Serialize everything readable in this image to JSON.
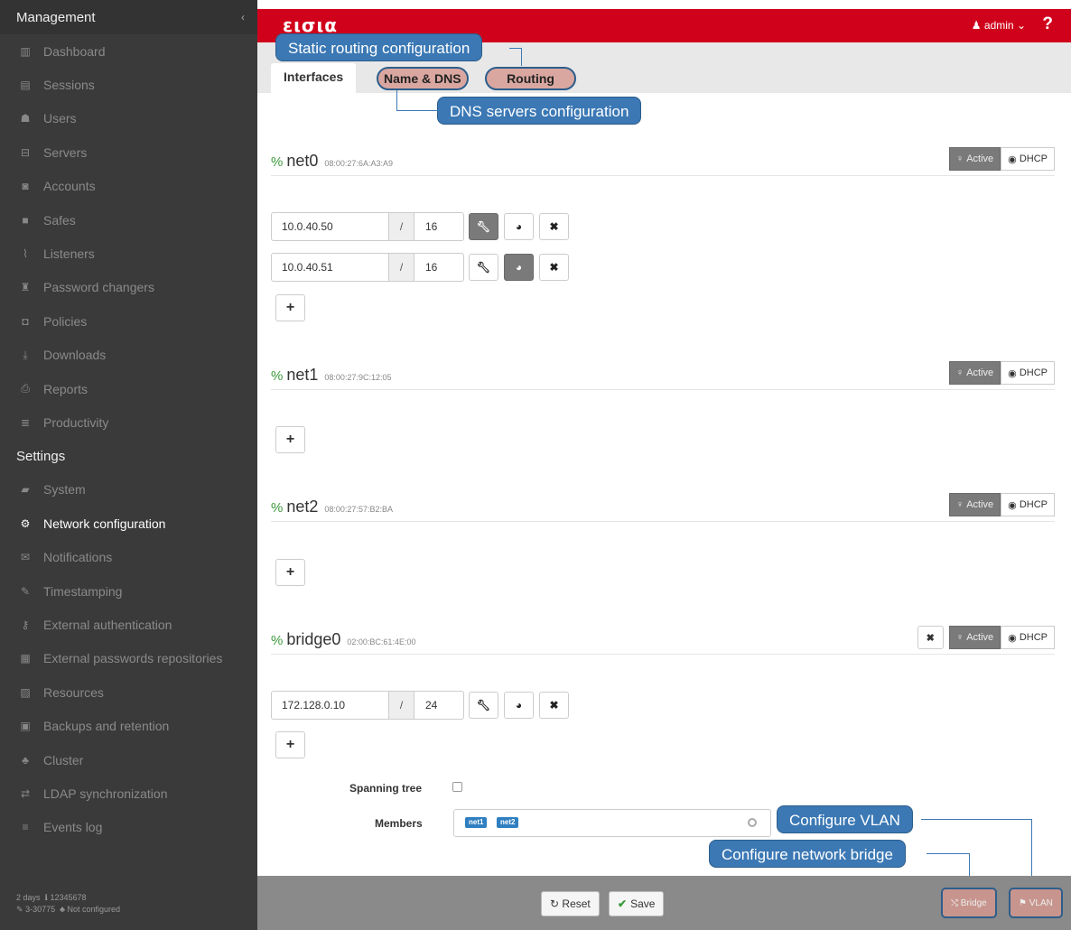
{
  "sidebar": {
    "management_title": "Management",
    "collapse_icon": "chevron-left-icon",
    "management_items": [
      {
        "label": "Dashboard",
        "icon": "dashboard-icon"
      },
      {
        "label": "Sessions",
        "icon": "sessions-icon"
      },
      {
        "label": "Users",
        "icon": "users-icon"
      },
      {
        "label": "Servers",
        "icon": "servers-icon"
      },
      {
        "label": "Accounts",
        "icon": "accounts-icon"
      },
      {
        "label": "Safes",
        "icon": "safes-icon"
      },
      {
        "label": "Listeners",
        "icon": "listeners-icon"
      },
      {
        "label": "Password changers",
        "icon": "password-changers-icon"
      },
      {
        "label": "Policies",
        "icon": "policies-icon"
      },
      {
        "label": "Downloads",
        "icon": "downloads-icon"
      },
      {
        "label": "Reports",
        "icon": "reports-icon"
      },
      {
        "label": "Productivity",
        "icon": "productivity-icon"
      }
    ],
    "settings_title": "Settings",
    "settings_items": [
      {
        "label": "System",
        "icon": "folder-icon"
      },
      {
        "label": "Network configuration",
        "icon": "gears-icon",
        "active": true
      },
      {
        "label": "Notifications",
        "icon": "envelope-icon"
      },
      {
        "label": "Timestamping",
        "icon": "edit-icon"
      },
      {
        "label": "External authentication",
        "icon": "key-icon"
      },
      {
        "label": "External passwords repositories",
        "icon": "grid-icon"
      },
      {
        "label": "Resources",
        "icon": "image-icon"
      },
      {
        "label": "Backups and retention",
        "icon": "archive-icon"
      },
      {
        "label": "Cluster",
        "icon": "sitemap-icon"
      },
      {
        "label": "LDAP synchronization",
        "icon": "exchange-icon"
      },
      {
        "label": "Events log",
        "icon": "list-icon"
      }
    ],
    "footer": {
      "uptime": "2 days",
      "serial": "12345678",
      "version": "3-30775",
      "cluster": "Not configured"
    }
  },
  "topbar": {
    "logo": "εισια",
    "user": "admin",
    "help": "?"
  },
  "tabs": {
    "interfaces": "Interfaces",
    "name_dns": "Name & DNS",
    "routing": "Routing"
  },
  "callouts": {
    "routing": "Static routing configuration",
    "dns": "DNS servers configuration",
    "vlan": "Configure VLAN",
    "bridge": "Configure network bridge"
  },
  "interfaces": [
    {
      "name": "net0",
      "mac": "08:00:27:6A:A3:A9",
      "active_label": "Active",
      "dhcp_label": "DHCP",
      "addresses": [
        {
          "ip": "10.0.40.50",
          "mask": "16"
        },
        {
          "ip": "10.0.40.51",
          "mask": "16"
        }
      ]
    },
    {
      "name": "net1",
      "mac": "08:00:27:9C:12:05",
      "active_label": "Active",
      "dhcp_label": "DHCP",
      "addresses": []
    },
    {
      "name": "net2",
      "mac": "08:00:27:57:B2:BA",
      "active_label": "Active",
      "dhcp_label": "DHCP",
      "addresses": []
    },
    {
      "name": "bridge0",
      "mac": "02:00:BC:61:4E:00",
      "active_label": "Active",
      "dhcp_label": "DHCP",
      "addresses": [
        {
          "ip": "172.128.0.10",
          "mask": "24"
        }
      ],
      "spanning_tree_label": "Spanning tree",
      "spanning_tree": false,
      "members_label": "Members",
      "members": [
        "net1",
        "net2"
      ]
    }
  ],
  "slash": "/",
  "bottom": {
    "reset": "Reset",
    "save": "Save",
    "bridge": "Bridge",
    "vlan": "VLAN"
  },
  "colors": {
    "brand": "#d0021b",
    "sidebar": "#3a3a3a",
    "callout": "#3b78b4",
    "link_green": "#3c9a3c"
  }
}
